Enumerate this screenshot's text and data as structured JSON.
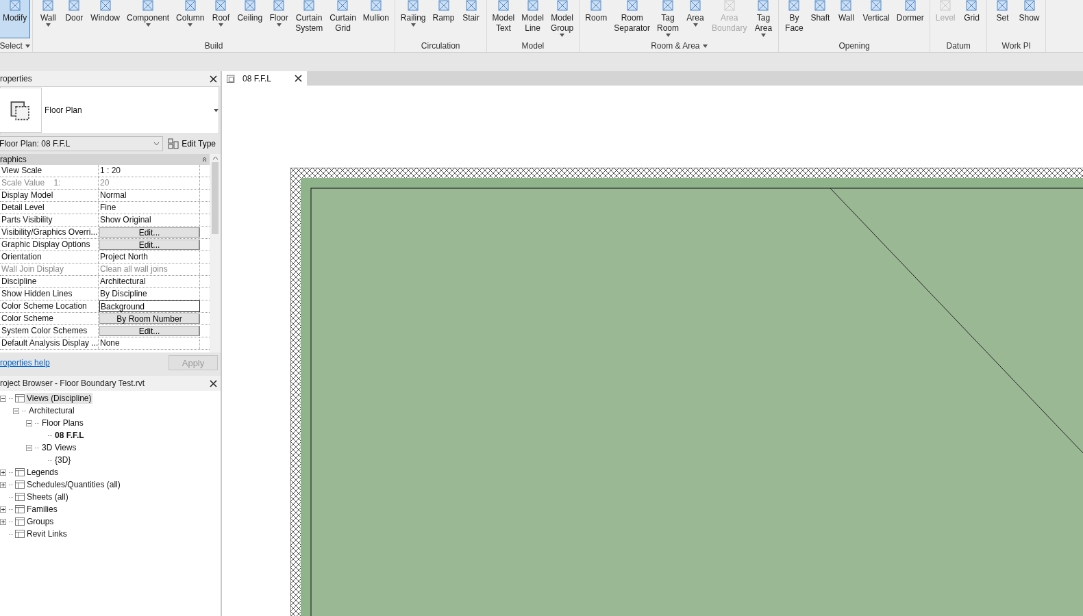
{
  "ribbon": {
    "groups": [
      {
        "label": "Select",
        "dropdown": true,
        "tools": [
          {
            "label": "Modify",
            "selected": true,
            "dropdown": false,
            "disabled": false
          }
        ]
      },
      {
        "label": "Build",
        "dropdown": false,
        "tools": [
          {
            "label": "Wall",
            "selected": false,
            "dropdown": true,
            "disabled": false
          },
          {
            "label": "Door",
            "selected": false,
            "dropdown": false,
            "disabled": false
          },
          {
            "label": "Window",
            "selected": false,
            "dropdown": false,
            "disabled": false
          },
          {
            "label": "Component",
            "selected": false,
            "dropdown": true,
            "disabled": false
          },
          {
            "label": "Column",
            "selected": false,
            "dropdown": true,
            "disabled": false
          },
          {
            "label": "Roof",
            "selected": false,
            "dropdown": true,
            "disabled": false
          },
          {
            "label": "Ceiling",
            "selected": false,
            "dropdown": false,
            "disabled": false
          },
          {
            "label": "Floor",
            "selected": false,
            "dropdown": true,
            "disabled": false
          },
          {
            "label": "Curtain\nSystem",
            "selected": false,
            "dropdown": false,
            "disabled": false
          },
          {
            "label": "Curtain\nGrid",
            "selected": false,
            "dropdown": false,
            "disabled": false
          },
          {
            "label": "Mullion",
            "selected": false,
            "dropdown": false,
            "disabled": false
          }
        ]
      },
      {
        "label": "Circulation",
        "dropdown": false,
        "tools": [
          {
            "label": "Railing",
            "selected": false,
            "dropdown": true,
            "disabled": false
          },
          {
            "label": "Ramp",
            "selected": false,
            "dropdown": false,
            "disabled": false
          },
          {
            "label": "Stair",
            "selected": false,
            "dropdown": false,
            "disabled": false
          }
        ]
      },
      {
        "label": "Model",
        "dropdown": false,
        "tools": [
          {
            "label": "Model\nText",
            "selected": false,
            "dropdown": false,
            "disabled": false
          },
          {
            "label": "Model\nLine",
            "selected": false,
            "dropdown": false,
            "disabled": false
          },
          {
            "label": "Model\nGroup",
            "selected": false,
            "dropdown": true,
            "disabled": false
          }
        ]
      },
      {
        "label": "Room & Area",
        "dropdown": true,
        "tools": [
          {
            "label": "Room",
            "selected": false,
            "dropdown": false,
            "disabled": false
          },
          {
            "label": "Room\nSeparator",
            "selected": false,
            "dropdown": false,
            "disabled": false
          },
          {
            "label": "Tag\nRoom",
            "selected": false,
            "dropdown": true,
            "disabled": false
          },
          {
            "label": "Area",
            "selected": false,
            "dropdown": true,
            "disabled": false
          },
          {
            "label": "Area\nBoundary",
            "selected": false,
            "dropdown": false,
            "disabled": true
          },
          {
            "label": "Tag\nArea",
            "selected": false,
            "dropdown": true,
            "disabled": false
          }
        ]
      },
      {
        "label": "Opening",
        "dropdown": false,
        "tools": [
          {
            "label": "By\nFace",
            "selected": false,
            "dropdown": false,
            "disabled": false
          },
          {
            "label": "Shaft",
            "selected": false,
            "dropdown": false,
            "disabled": false
          },
          {
            "label": "Wall",
            "selected": false,
            "dropdown": false,
            "disabled": false
          },
          {
            "label": "Vertical",
            "selected": false,
            "dropdown": false,
            "disabled": false
          },
          {
            "label": "Dormer",
            "selected": false,
            "dropdown": false,
            "disabled": false
          }
        ]
      },
      {
        "label": "Datum",
        "dropdown": false,
        "tools": [
          {
            "label": "Level",
            "selected": false,
            "dropdown": false,
            "disabled": true
          },
          {
            "label": "Grid",
            "selected": false,
            "dropdown": false,
            "disabled": false
          }
        ]
      },
      {
        "label": "Work Pl",
        "dropdown": false,
        "tools": [
          {
            "label": "Set",
            "selected": false,
            "dropdown": false,
            "disabled": false
          },
          {
            "label": "Show",
            "selected": false,
            "dropdown": false,
            "disabled": false
          }
        ]
      }
    ]
  },
  "properties": {
    "title": "roperties",
    "type_name": "Floor Plan",
    "selector": "Floor Plan: 08 F.F.L",
    "edit_type": "Edit Type",
    "section": "raphics",
    "rows": [
      {
        "name": "View Scale",
        "value": "1 : 20",
        "kind": "text",
        "disabled": false
      },
      {
        "name": "Scale Value    1:",
        "value": "20",
        "kind": "text",
        "disabled": true
      },
      {
        "name": "Display Model",
        "value": "Normal",
        "kind": "text",
        "disabled": false
      },
      {
        "name": "Detail Level",
        "value": "Fine",
        "kind": "text",
        "disabled": false
      },
      {
        "name": "Parts Visibility",
        "value": "Show Original",
        "kind": "text",
        "disabled": false
      },
      {
        "name": "Visibility/Graphics Overri...",
        "value": "Edit...",
        "kind": "button",
        "disabled": false
      },
      {
        "name": "Graphic Display Options",
        "value": "Edit...",
        "kind": "button",
        "disabled": false
      },
      {
        "name": "Orientation",
        "value": "Project North",
        "kind": "text",
        "disabled": false
      },
      {
        "name": "Wall Join Display",
        "value": "Clean all wall joins",
        "kind": "text",
        "disabled": true
      },
      {
        "name": "Discipline",
        "value": "Architectural",
        "kind": "text",
        "disabled": false
      },
      {
        "name": "Show Hidden Lines",
        "value": "By Discipline",
        "kind": "text",
        "disabled": false
      },
      {
        "name": "Color Scheme Location",
        "value": "Background",
        "kind": "field",
        "disabled": false
      },
      {
        "name": "Color Scheme",
        "value": "By Room Number",
        "kind": "button",
        "disabled": false
      },
      {
        "name": "System Color Schemes",
        "value": "Edit...",
        "kind": "button",
        "disabled": false
      },
      {
        "name": "Default Analysis Display ...",
        "value": "None",
        "kind": "text",
        "disabled": false
      }
    ],
    "help": "roperties help",
    "apply": {
      "label": "Apply",
      "disabled": true
    }
  },
  "browser": {
    "title": "roject Browser - Floor Boundary Test.rvt",
    "tree": [
      {
        "label": "Views (Discipline)",
        "expanded": true,
        "selected": true,
        "current": false,
        "children": [
          {
            "label": "Architectural",
            "expanded": true,
            "selected": false,
            "current": false,
            "children": [
              {
                "label": "Floor Plans",
                "expanded": true,
                "selected": false,
                "current": false,
                "children": [
                  {
                    "label": "08 F.F.L",
                    "selected": false,
                    "current": true
                  }
                ]
              },
              {
                "label": "3D Views",
                "expanded": true,
                "selected": false,
                "current": false,
                "children": [
                  {
                    "label": "{3D}",
                    "selected": false,
                    "current": false
                  }
                ]
              }
            ]
          }
        ]
      },
      {
        "label": "Legends",
        "expanded": false,
        "selected": false,
        "current": false
      },
      {
        "label": "Schedules/Quantities (all)",
        "expanded": false,
        "selected": false,
        "current": false
      },
      {
        "label": "Sheets (all)",
        "selected": false,
        "current": false
      },
      {
        "label": "Families",
        "expanded": false,
        "selected": false,
        "current": false
      },
      {
        "label": "Groups",
        "expanded": false,
        "selected": false,
        "current": false
      },
      {
        "label": "Revit Links",
        "selected": false,
        "current": false
      }
    ]
  },
  "view_tabs": [
    {
      "label": "08 F.F.L",
      "selected": true
    }
  ]
}
